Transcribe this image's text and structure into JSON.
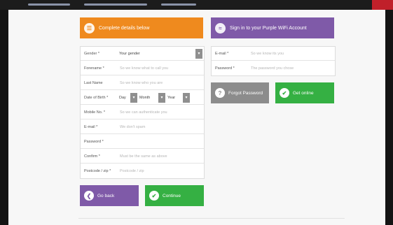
{
  "colors": {
    "orange": "#ef8a1e",
    "purple": "#7f5aa8",
    "green": "#35b043",
    "grey": "#8c8c8c"
  },
  "register": {
    "header": "Complete details below",
    "header_icon": "form-icon",
    "fields": {
      "gender": {
        "label": "Gender *",
        "value": "Your gender"
      },
      "forename": {
        "label": "Forename *",
        "placeholder": "So we know what to call you"
      },
      "lastname": {
        "label": "Last Name",
        "placeholder": "So we know who you are"
      },
      "dob": {
        "label": "Date of Birth *",
        "day": "Day",
        "month": "Month",
        "year": "Year"
      },
      "mobile": {
        "label": "Mobile No. *",
        "placeholder": "So we can authenticate you"
      },
      "email": {
        "label": "E-mail *",
        "placeholder": "We don't spam"
      },
      "password": {
        "label": "Password *",
        "placeholder": ""
      },
      "confirm": {
        "label": "Confirm *",
        "placeholder": "Must be the same as above"
      },
      "postcode": {
        "label": "Postcode / zip *",
        "placeholder": "Postcode / zip"
      }
    },
    "back_label": "Go back",
    "continue_label": "Continue"
  },
  "signin": {
    "header": "Sign in to your Purple WiFi Account",
    "header_icon": "wifi-icon",
    "email": {
      "label": "E-mail *",
      "placeholder": "So we know its you"
    },
    "password": {
      "label": "Password *",
      "placeholder": "The password you chose"
    },
    "forgot_label": "Forgot Password",
    "login_label": "Get online"
  }
}
